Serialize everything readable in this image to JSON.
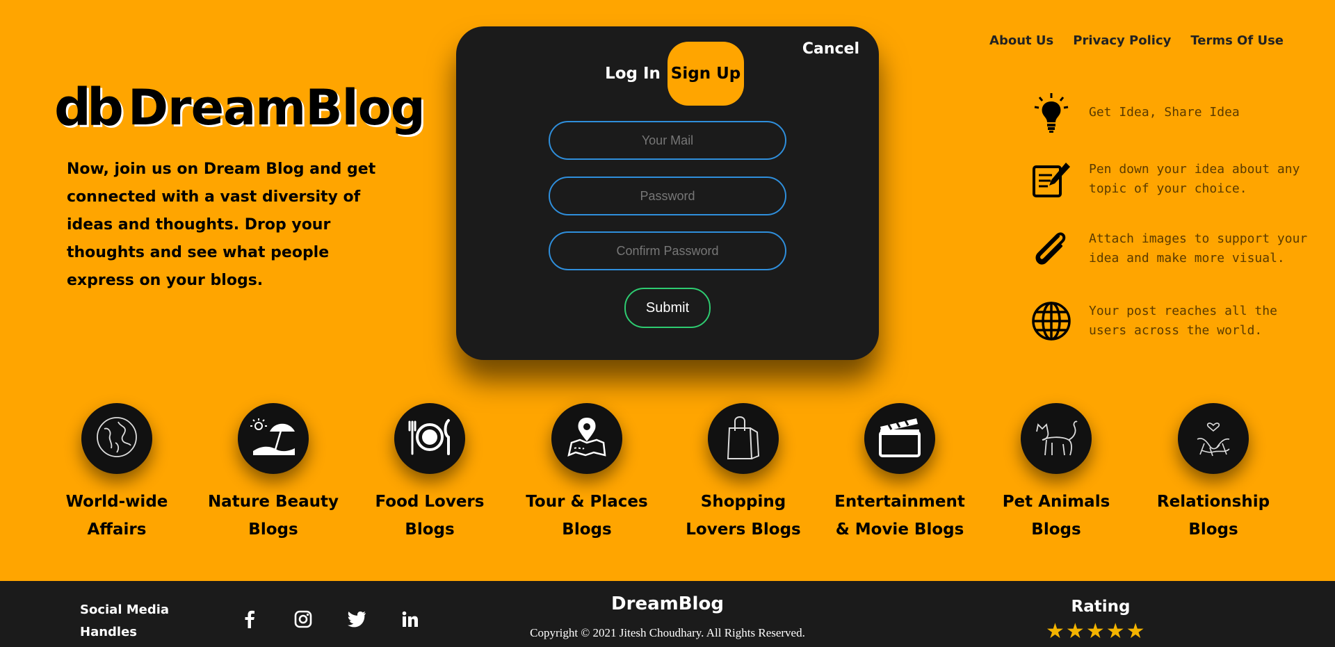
{
  "brand": {
    "logo": "db",
    "name": "DreamBlog"
  },
  "intro": "Now, join us on Dream Blog and get connected with a vast diversity of ideas and thoughts. Drop your thoughts and see what people express on your blogs.",
  "modal": {
    "cancel_label": "Cancel",
    "tabs": {
      "login": "Log In",
      "signup": "Sign Up",
      "active": "signup"
    },
    "fields": {
      "mail_placeholder": "Your Mail",
      "password_placeholder": "Password",
      "confirm_placeholder": "Confirm Password"
    },
    "submit_label": "Submit",
    "colors": {
      "field_border": "#2f8fdc",
      "submit_border": "#2ecc71",
      "panel": "#1b1b1b"
    }
  },
  "nav": [
    {
      "label": "About Us"
    },
    {
      "label": "Privacy Policy"
    },
    {
      "label": "Terms Of Use"
    }
  ],
  "features": [
    {
      "icon": "lightbulb-icon",
      "text": "Get Idea, Share Idea"
    },
    {
      "icon": "pen-notepad-icon",
      "text": "Pen down your idea about any topic of your choice."
    },
    {
      "icon": "paperclip-icon",
      "text": "Attach images to support your idea and make more visual."
    },
    {
      "icon": "globe-icon",
      "text": "Your post reaches all the users across the world."
    }
  ],
  "categories": [
    {
      "icon": "earth-icon",
      "label": "World-wide\nAffairs"
    },
    {
      "icon": "beach-umbrella-icon",
      "label": "Nature Beauty\nBlogs"
    },
    {
      "icon": "plate-cutlery-icon",
      "label": "Food Lovers\nBlogs"
    },
    {
      "icon": "map-pin-icon",
      "label": "Tour & Places\nBlogs"
    },
    {
      "icon": "shopping-bag-icon",
      "label": "Shopping\nLovers Blogs"
    },
    {
      "icon": "clapperboard-icon",
      "label": "Entertainment\n& Movie Blogs"
    },
    {
      "icon": "cat-icon",
      "label": "Pet Animals\nBlogs"
    },
    {
      "icon": "couple-heart-icon",
      "label": "Relationship\nBlogs"
    }
  ],
  "footer": {
    "social_title": "Social Media Handles",
    "socials": [
      "facebook-icon",
      "instagram-icon",
      "twitter-icon",
      "linkedin-icon"
    ],
    "brand": "DreamBlog",
    "copyright": "Copyright © 2021 Jitesh Choudhary. All Rights Reserved.",
    "rating_title": "Rating",
    "rating": 5
  },
  "colors": {
    "background": "#FFA500",
    "dark": "#1b1b1b",
    "star": "#f4b400"
  }
}
